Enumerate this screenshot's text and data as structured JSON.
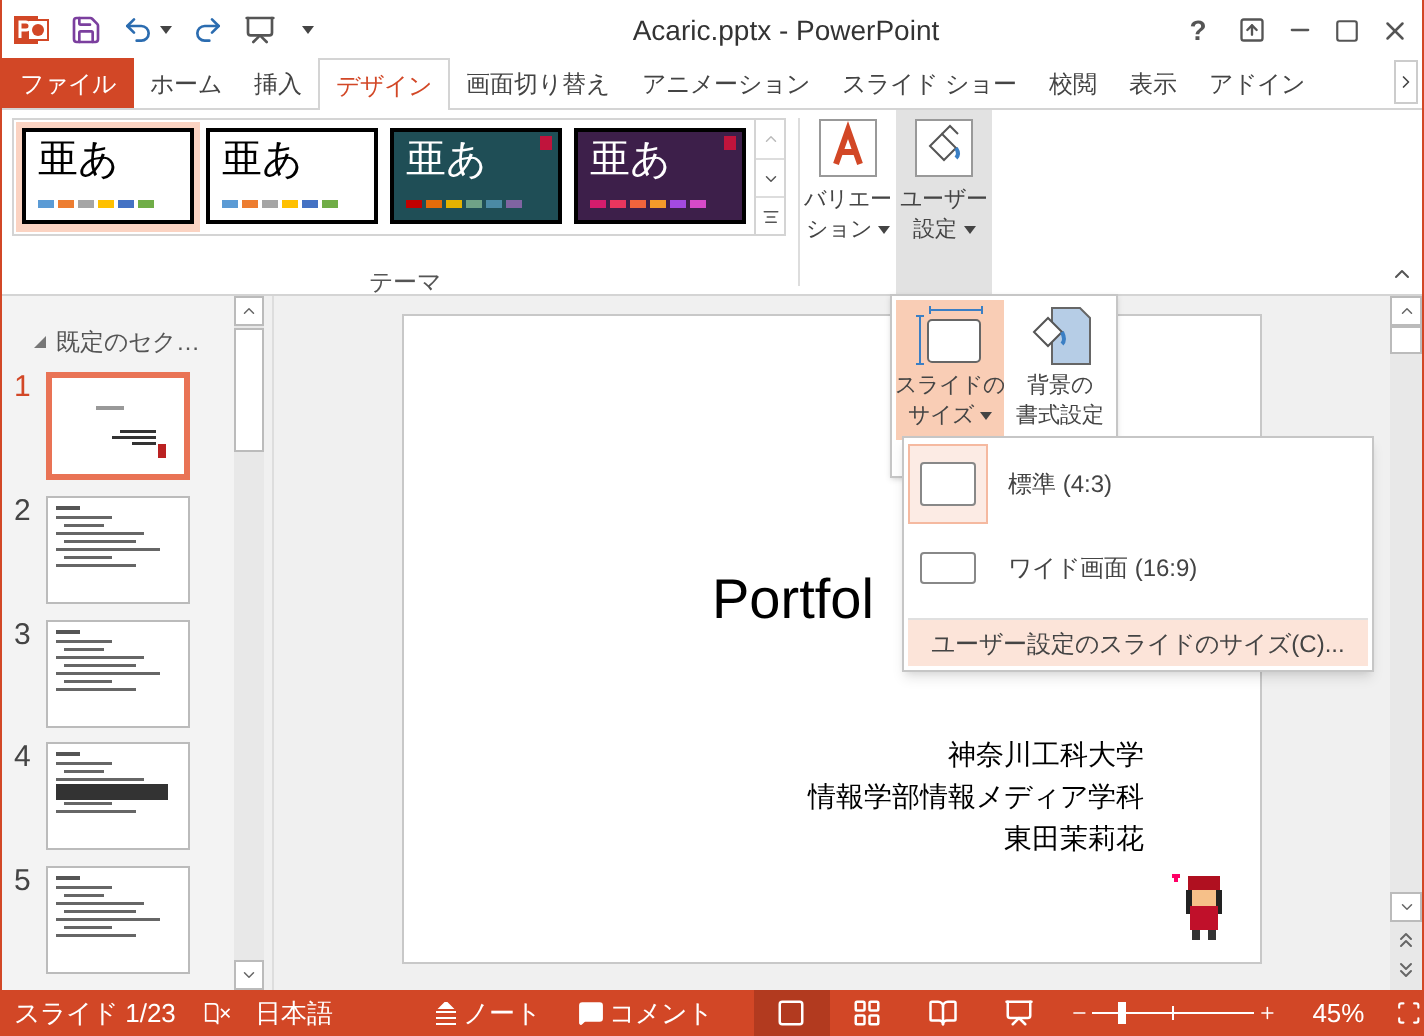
{
  "window": {
    "title": "Acaric.pptx - PowerPoint",
    "help": "?"
  },
  "tabs": [
    {
      "label": "ファイル",
      "kind": "file",
      "selected": false
    },
    {
      "label": "ホーム",
      "kind": "tab",
      "selected": false
    },
    {
      "label": "挿入",
      "kind": "tab",
      "selected": false
    },
    {
      "label": "デザイン",
      "kind": "tab",
      "selected": true
    },
    {
      "label": "画面切り替え",
      "kind": "tab",
      "selected": false
    },
    {
      "label": "アニメーション",
      "kind": "tab",
      "selected": false
    },
    {
      "label": "スライド ショー",
      "kind": "tab",
      "selected": false
    },
    {
      "label": "校閲",
      "kind": "tab",
      "selected": false
    },
    {
      "label": "表示",
      "kind": "tab",
      "selected": false
    },
    {
      "label": "アドイン",
      "kind": "tab",
      "selected": false
    }
  ],
  "ribbon": {
    "themes": [
      {
        "sample": "亜あ",
        "kind": "light",
        "selected": true,
        "swatches": [
          {
            "color": "#5b9bd5"
          },
          {
            "color": "#ed7d31"
          },
          {
            "color": "#a5a5a5"
          },
          {
            "color": "#ffc000"
          },
          {
            "color": "#4472c4"
          },
          {
            "color": "#70ad47"
          }
        ]
      },
      {
        "sample": "亜あ",
        "kind": "light",
        "selected": false,
        "swatches": [
          {
            "color": "#5b9bd5"
          },
          {
            "color": "#ed7d31"
          },
          {
            "color": "#a5a5a5"
          },
          {
            "color": "#ffc000"
          },
          {
            "color": "#4472c4"
          },
          {
            "color": "#70ad47"
          }
        ]
      },
      {
        "sample": "亜あ",
        "kind": "teal",
        "selected": false,
        "swatches": [
          {
            "color": "#c00000"
          },
          {
            "color": "#e46c0a"
          },
          {
            "color": "#e4b200"
          },
          {
            "color": "#6fa287"
          },
          {
            "color": "#4b8aa5"
          },
          {
            "color": "#8064a2"
          }
        ]
      },
      {
        "sample": "亜あ",
        "kind": "purple",
        "selected": false,
        "swatches": [
          {
            "color": "#d41c6d"
          },
          {
            "color": "#e8365e"
          },
          {
            "color": "#f0643c"
          },
          {
            "color": "#f39a2a"
          },
          {
            "color": "#a34ae0"
          },
          {
            "color": "#d64ac8"
          }
        ]
      }
    ],
    "group_label": "テーマ",
    "buttons": [
      {
        "lines": [
          "バリエー",
          "ション"
        ],
        "kind": "variants",
        "expanded": false
      },
      {
        "lines": [
          "ユーザー",
          "設定"
        ],
        "kind": "customize",
        "expanded": true
      }
    ]
  },
  "customize_popup": {
    "buttons": [
      {
        "lines": [
          "スライドの",
          "サイズ"
        ],
        "kind": "slide-size",
        "expanded": true
      },
      {
        "lines": [
          "背景の",
          "書式設定"
        ],
        "kind": "background",
        "expanded": false
      }
    ]
  },
  "size_menu": {
    "items": [
      {
        "label": "標準 (4:3)",
        "kind": "standard",
        "selected": true
      },
      {
        "label": "ワイド画面 (16:9)",
        "kind": "wide",
        "selected": false
      },
      {
        "label": "ユーザー設定のスライドのサイズ(C)...",
        "kind": "command",
        "hovered": true
      }
    ]
  },
  "slides_pane": {
    "section": "既定のセク…",
    "slides": [
      {
        "number": "1",
        "kind": "title",
        "selected": true
      },
      {
        "number": "2",
        "kind": "content",
        "selected": false
      },
      {
        "number": "3",
        "kind": "content",
        "selected": false
      },
      {
        "number": "4",
        "kind": "banner",
        "selected": false
      },
      {
        "number": "5",
        "kind": "content",
        "selected": false
      }
    ]
  },
  "slide": {
    "title": "Portfol",
    "subtitle": [
      "神奈川工科大学",
      "情報学部情報メディア学科",
      "東田茉莉花"
    ]
  },
  "status_bar": {
    "slide": "スライド 1/23",
    "language": "日本語",
    "notes": "ノート",
    "comments": "コメント",
    "views": [
      {
        "kind": "normal",
        "selected": true
      },
      {
        "kind": "sorter",
        "selected": false
      },
      {
        "kind": "reading",
        "selected": false
      },
      {
        "kind": "show",
        "selected": false
      }
    ],
    "zoom": {
      "level": 0.19,
      "reading": "45%"
    }
  }
}
